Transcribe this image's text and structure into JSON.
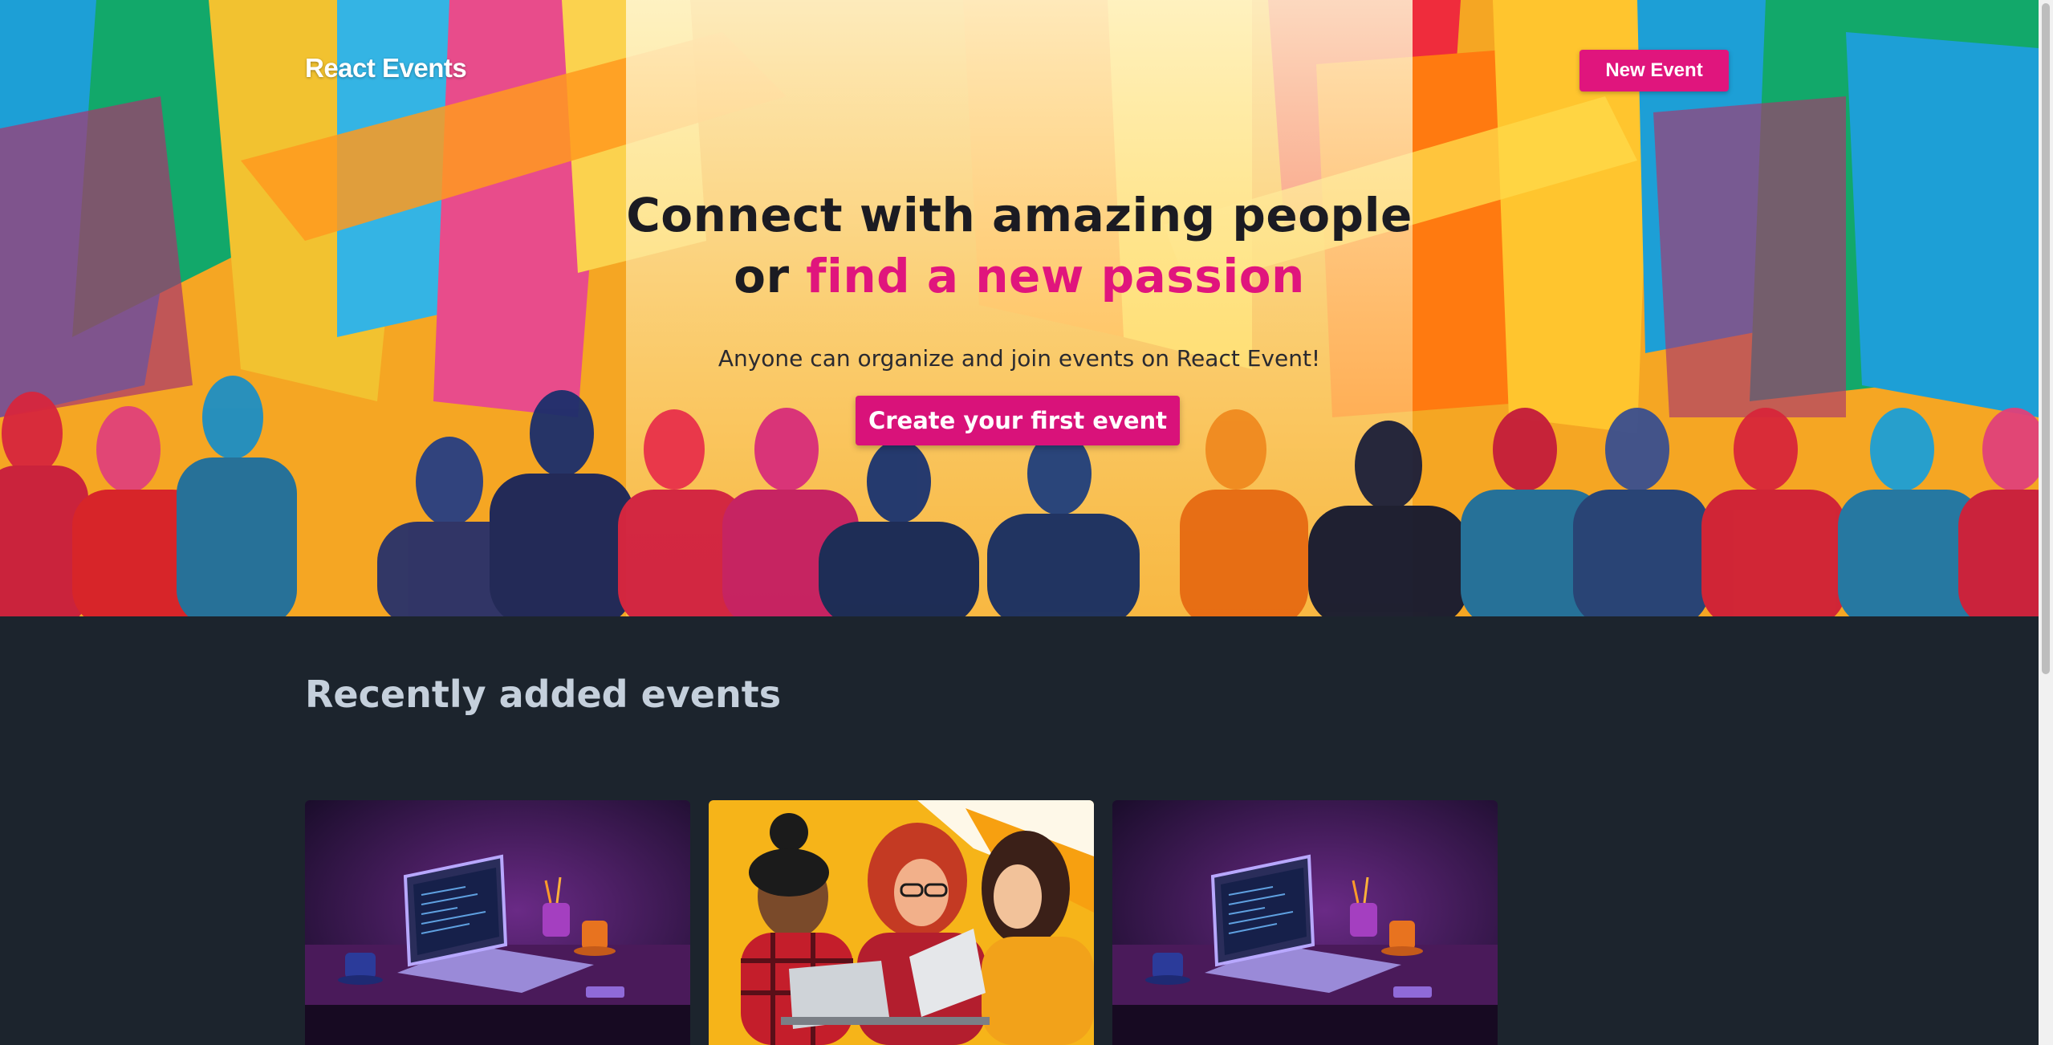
{
  "nav": {
    "brand": "React Events",
    "new_event_label": "New Event"
  },
  "hero": {
    "headline_line1": "Connect with amazing people",
    "headline_line2_prefix": "or",
    "headline_line2_accent": "find a new passion",
    "subtitle": "Anyone can organize and join events on React Event!",
    "cta_label": "Create your first event"
  },
  "events": {
    "section_title": "Recently added events",
    "cards": [
      {
        "image": "laptop-desk-illustration"
      },
      {
        "image": "three-women-laptop-illustration"
      },
      {
        "image": "laptop-desk-illustration"
      }
    ]
  },
  "colors": {
    "accent": "#e0157d",
    "page_background": "#1c242d",
    "section_title": "#c5d0dc"
  }
}
